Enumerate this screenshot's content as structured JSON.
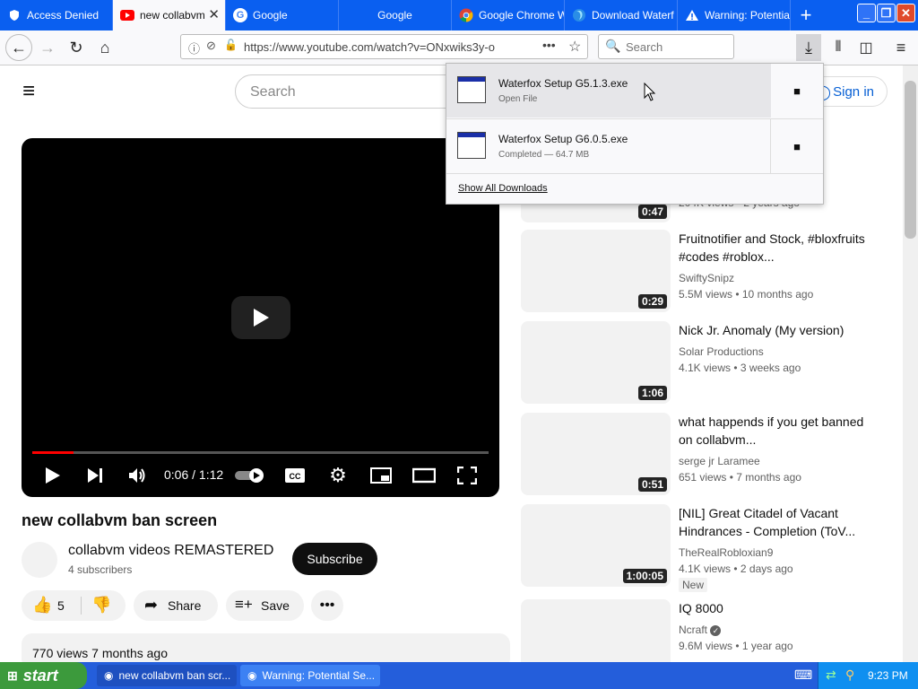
{
  "tabs": [
    {
      "label": "Access Denied",
      "icon": "shield-icon"
    },
    {
      "label": "new collabvm",
      "icon": "youtube-icon",
      "active": true
    },
    {
      "label": "Google",
      "icon": "google-icon"
    },
    {
      "label": "Google",
      "icon": "none"
    },
    {
      "label": "Google Chrome W",
      "icon": "chrome-icon"
    },
    {
      "label": "Download Waterf",
      "icon": "waterfox-icon"
    },
    {
      "label": "Warning: Potentia",
      "icon": "warning-icon"
    }
  ],
  "nav": {
    "url": "https://www.youtube.com/watch?v=ONxwiks3y-o",
    "search_placeholder": "Search"
  },
  "youtube": {
    "search_placeholder": "Search",
    "sign_in": "Sign in",
    "player": {
      "time": "0:06 / 1:12",
      "progress": 0.09
    },
    "video_title": "new collabvm ban screen",
    "channel_name": "collabvm videos REMASTERED",
    "subscribers": "4 subscribers",
    "subscribe_label": "Subscribe",
    "like_count": "5",
    "share_label": "Share",
    "save_label": "Save",
    "description": "770 views  7 months ago"
  },
  "related": [
    {
      "title": "",
      "channel": "",
      "meta": "204K views  • 2 years ago",
      "duration": "0:47"
    },
    {
      "title": "Fruitnotifier and Stock, #bloxfruits #codes #roblox...",
      "channel": "SwiftySnipz",
      "meta": "5.5M views  • 10 months ago",
      "duration": "0:29"
    },
    {
      "title": "Nick Jr. Anomaly (My version)",
      "channel": "Solar Productions",
      "meta": "4.1K views  • 3 weeks ago",
      "duration": "1:06"
    },
    {
      "title": "what happends if you get banned on collabvm...",
      "channel": "serge jr Laramee",
      "meta": "651 views  • 7 months ago",
      "duration": "0:51"
    },
    {
      "title": "[NIL] Great Citadel of Vacant Hindrances - Completion (ToV...",
      "channel": "TheRealRobloxian9",
      "meta": "4.1K views  • 2 days ago",
      "duration": "1:00:05",
      "badge": "New"
    },
    {
      "title": "IQ 8000",
      "channel": "Ncraft",
      "meta": "9.6M views  • 1 year ago",
      "duration": "",
      "verified": true
    }
  ],
  "downloads": {
    "items": [
      {
        "name": "Waterfox Setup G5.1.3.exe",
        "status": "Open File"
      },
      {
        "name": "Waterfox Setup G6.0.5.exe",
        "status": "Completed — 64.7 MB"
      }
    ],
    "show_all": "Show All Downloads"
  },
  "taskbar": {
    "start": "start",
    "tasks": [
      {
        "label": "new collabvm ban scr..."
      },
      {
        "label": "Warning: Potential Se..."
      }
    ],
    "clock": "9:23 PM"
  },
  "colors": {
    "tabbar": "#0a5ff0",
    "taskbar": "#245edb",
    "start": "#3c9a3c",
    "progress": "#ff0000",
    "link": "#065fd4"
  }
}
